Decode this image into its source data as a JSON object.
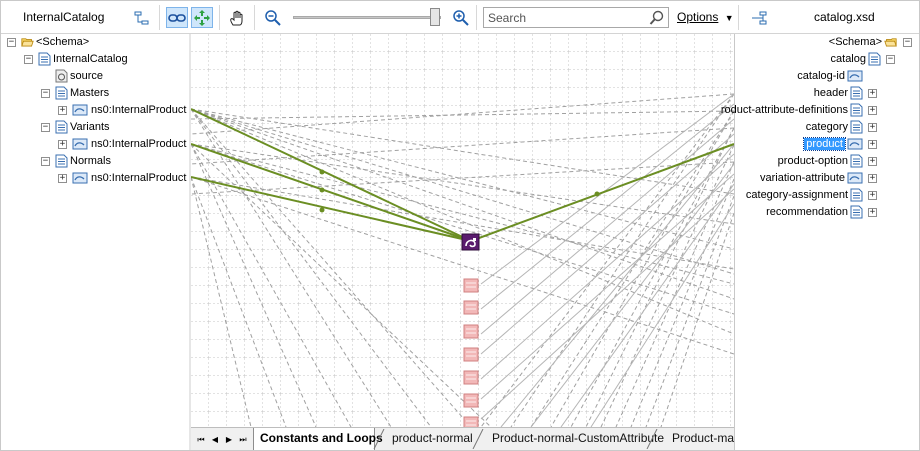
{
  "toolbar": {
    "left_title": "InternalCatalog",
    "right_title": "catalog.xsd",
    "search_placeholder": "Search",
    "options_label": "Options",
    "icons": [
      "autosize-icon",
      "link-mode-icon",
      "fit-icon",
      "hand-pan-icon",
      "zoom-out-icon",
      "zoom-in-icon",
      "search-icon",
      "dropdown-icon",
      "map-right-icon"
    ]
  },
  "left_tree": {
    "root": "<Schema>",
    "items": [
      {
        "label": "InternalCatalog"
      },
      {
        "label": "source"
      },
      {
        "label": "Masters"
      },
      {
        "label": "ns0:InternalProduct"
      },
      {
        "label": "Variants"
      },
      {
        "label": "ns0:InternalProduct"
      },
      {
        "label": "Normals"
      },
      {
        "label": "ns0:InternalProduct"
      }
    ]
  },
  "right_tree": {
    "root": "<Schema>",
    "items": [
      {
        "label": "catalog"
      },
      {
        "label": "catalog-id"
      },
      {
        "label": "header"
      },
      {
        "label": "roduct-attribute-definitions"
      },
      {
        "label": "category"
      },
      {
        "label": "product",
        "selected": true
      },
      {
        "label": "product-option"
      },
      {
        "label": "variation-attribute"
      },
      {
        "label": "category-assignment"
      },
      {
        "label": "recommendation"
      }
    ]
  },
  "tabs": [
    {
      "label": "Constants and Loops",
      "active": true
    },
    {
      "label": "product-normal",
      "active": false
    },
    {
      "label": "Product-normal-CustomAttribute",
      "active": false
    },
    {
      "label": "Product-mast",
      "active": false
    }
  ],
  "colors": {
    "link_green": "#6b8e23",
    "functoid_purple": "#5a1b6e",
    "functoid_pink": "#f2b8b8",
    "selection_blue": "#3399ff"
  }
}
